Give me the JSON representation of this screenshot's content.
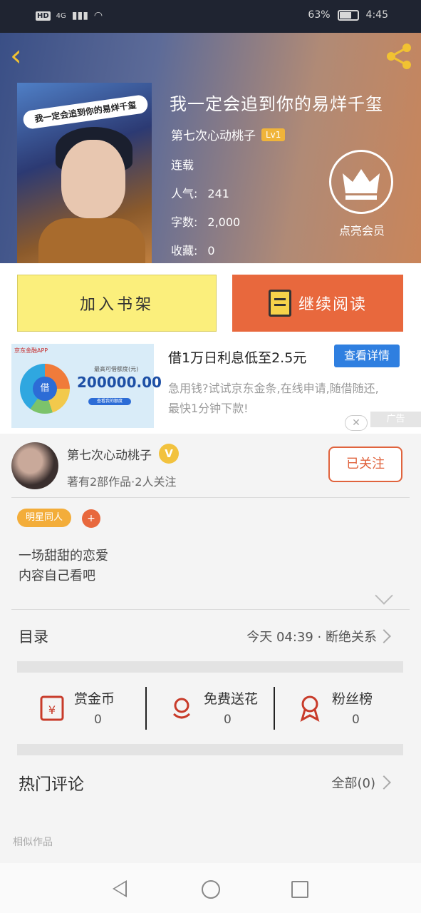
{
  "status_bar": {
    "network_badge": "HD",
    "network_type": "4G",
    "battery": "63%",
    "battery_level": 0.63,
    "time": "4:45"
  },
  "header": {
    "back_icon": "back-arrow-icon",
    "share_icon": "share-icon",
    "cover_caption": "我一定会追到你的易烊千玺"
  },
  "book": {
    "title": "我一定会追到你的易烊千玺",
    "author": "第七次心动桃子",
    "level": "Lv1",
    "status": "连载",
    "popularity_label": "人气:",
    "popularity": "241",
    "word_count_label": "字数:",
    "word_count": "2,000",
    "favorites_label": "收藏:",
    "favorites": "0"
  },
  "vip": {
    "icon": "crown-icon",
    "label": "点亮会员"
  },
  "actions": {
    "add_to_shelf": "加入书架",
    "continue_reading": "继续阅读"
  },
  "ad": {
    "img_logo": "京东金融APP",
    "img_caption": "最高可借额度(元)",
    "img_amount": "200000.00",
    "img_gauge_label": "借",
    "img_button": "查看我的额度",
    "title": "借1万日利息低至2.5元",
    "button": "查看详情",
    "description": "急用钱?试试京东金条,在线申请,随借随还,最快1分钟下款!",
    "tag": "广告",
    "close": "✕"
  },
  "author_section": {
    "name": "第七次心动桃子",
    "verified_badge": "V",
    "stats": "著有2部作品·2人关注",
    "follow_button": "已关注"
  },
  "tags": {
    "items": [
      "明星同人"
    ],
    "add": "+"
  },
  "intro": {
    "line1": "一场甜甜的恋爱",
    "line2": "内容自己看吧"
  },
  "catalog": {
    "label": "目录",
    "latest": "今天 04:39 · 断绝关系"
  },
  "stats": {
    "items": [
      {
        "name": "赏金币",
        "value": "0",
        "icon": "red-envelope-icon"
      },
      {
        "name": "免费送花",
        "value": "0",
        "icon": "flower-icon"
      },
      {
        "name": "粉丝榜",
        "value": "0",
        "icon": "medal-icon"
      }
    ]
  },
  "comments": {
    "label": "热门评论",
    "all": "全部(0)"
  },
  "similar": {
    "label": "相似作品"
  },
  "colors": {
    "accent_orange": "#e8683d",
    "shelf_yellow": "#fbef7c",
    "gold": "#f1c232",
    "ad_blue": "#2f7fe0"
  }
}
